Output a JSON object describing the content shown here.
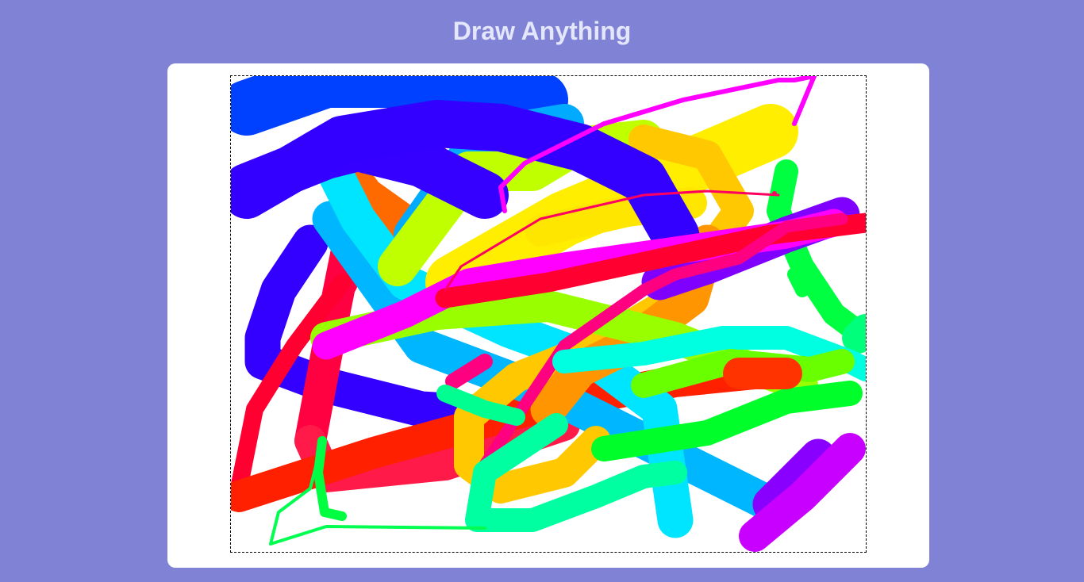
{
  "page": {
    "title": "Draw Anything"
  },
  "colors": {
    "background": "#8082d6",
    "title": "#e4e6fb",
    "card": "#ffffff",
    "canvas_border": "#000000"
  },
  "canvas": {
    "stroke_style": "rainbow-hue",
    "line_cap": "round"
  }
}
